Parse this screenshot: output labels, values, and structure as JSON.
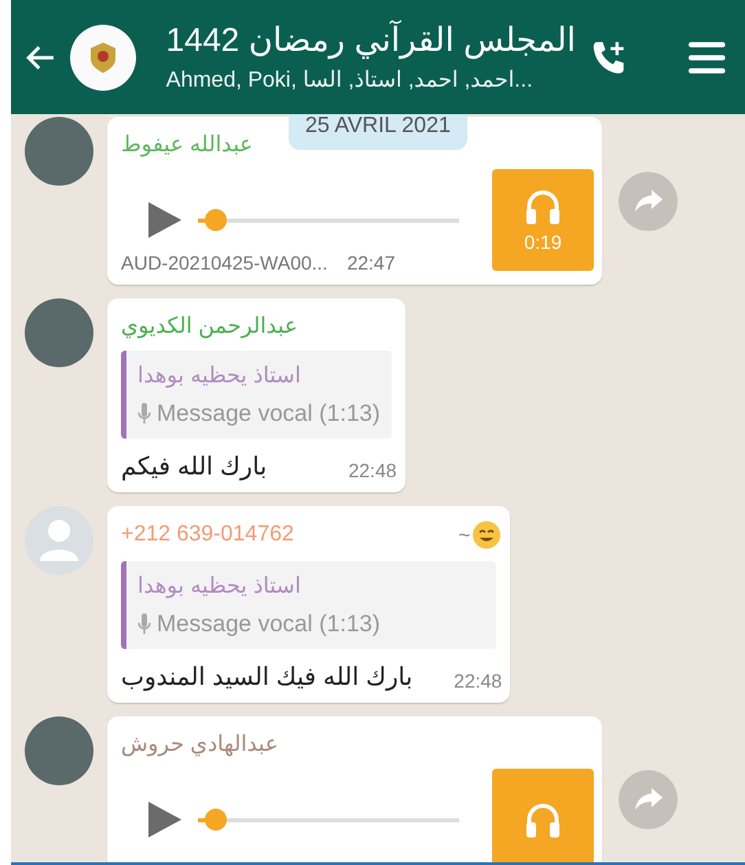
{
  "header": {
    "title": "المجلس القرآني رمضان 1442",
    "subtitle": "Ahmed, Poki, احمد, احمد, استاذ, السا..."
  },
  "date_chip": "25 AVRIL 2021",
  "messages": [
    {
      "kind": "audio",
      "has_photo": true,
      "sender": "عبدالله عيفوط",
      "color": "#5cb85c",
      "level": 0.03,
      "duration": "0:19",
      "file": "AUD-20210425-WA00...",
      "time": "22:47"
    },
    {
      "kind": "reply",
      "has_photo": true,
      "sender": "عبدالرحمن الكديوي",
      "color": "#4caf50",
      "quote_author": "استاذ يحظيه بوهدا",
      "quote_text": "Message vocal (1:13)",
      "text": "بارك الله فيكم",
      "time": "22:48"
    },
    {
      "kind": "reply",
      "has_photo": false,
      "sender": "+212 639-014762",
      "color": "#f29b74",
      "tag": "~",
      "quote_author": "استاذ يحظيه بوهدا",
      "quote_text": "Message vocal (1:13)",
      "text": "بارك الله فيك السيد المندوب",
      "time": "22:48"
    },
    {
      "kind": "audio",
      "has_photo": true,
      "sender": "عبدالهادي حروش",
      "color": "#a88a7a",
      "level": 0.03
    }
  ]
}
